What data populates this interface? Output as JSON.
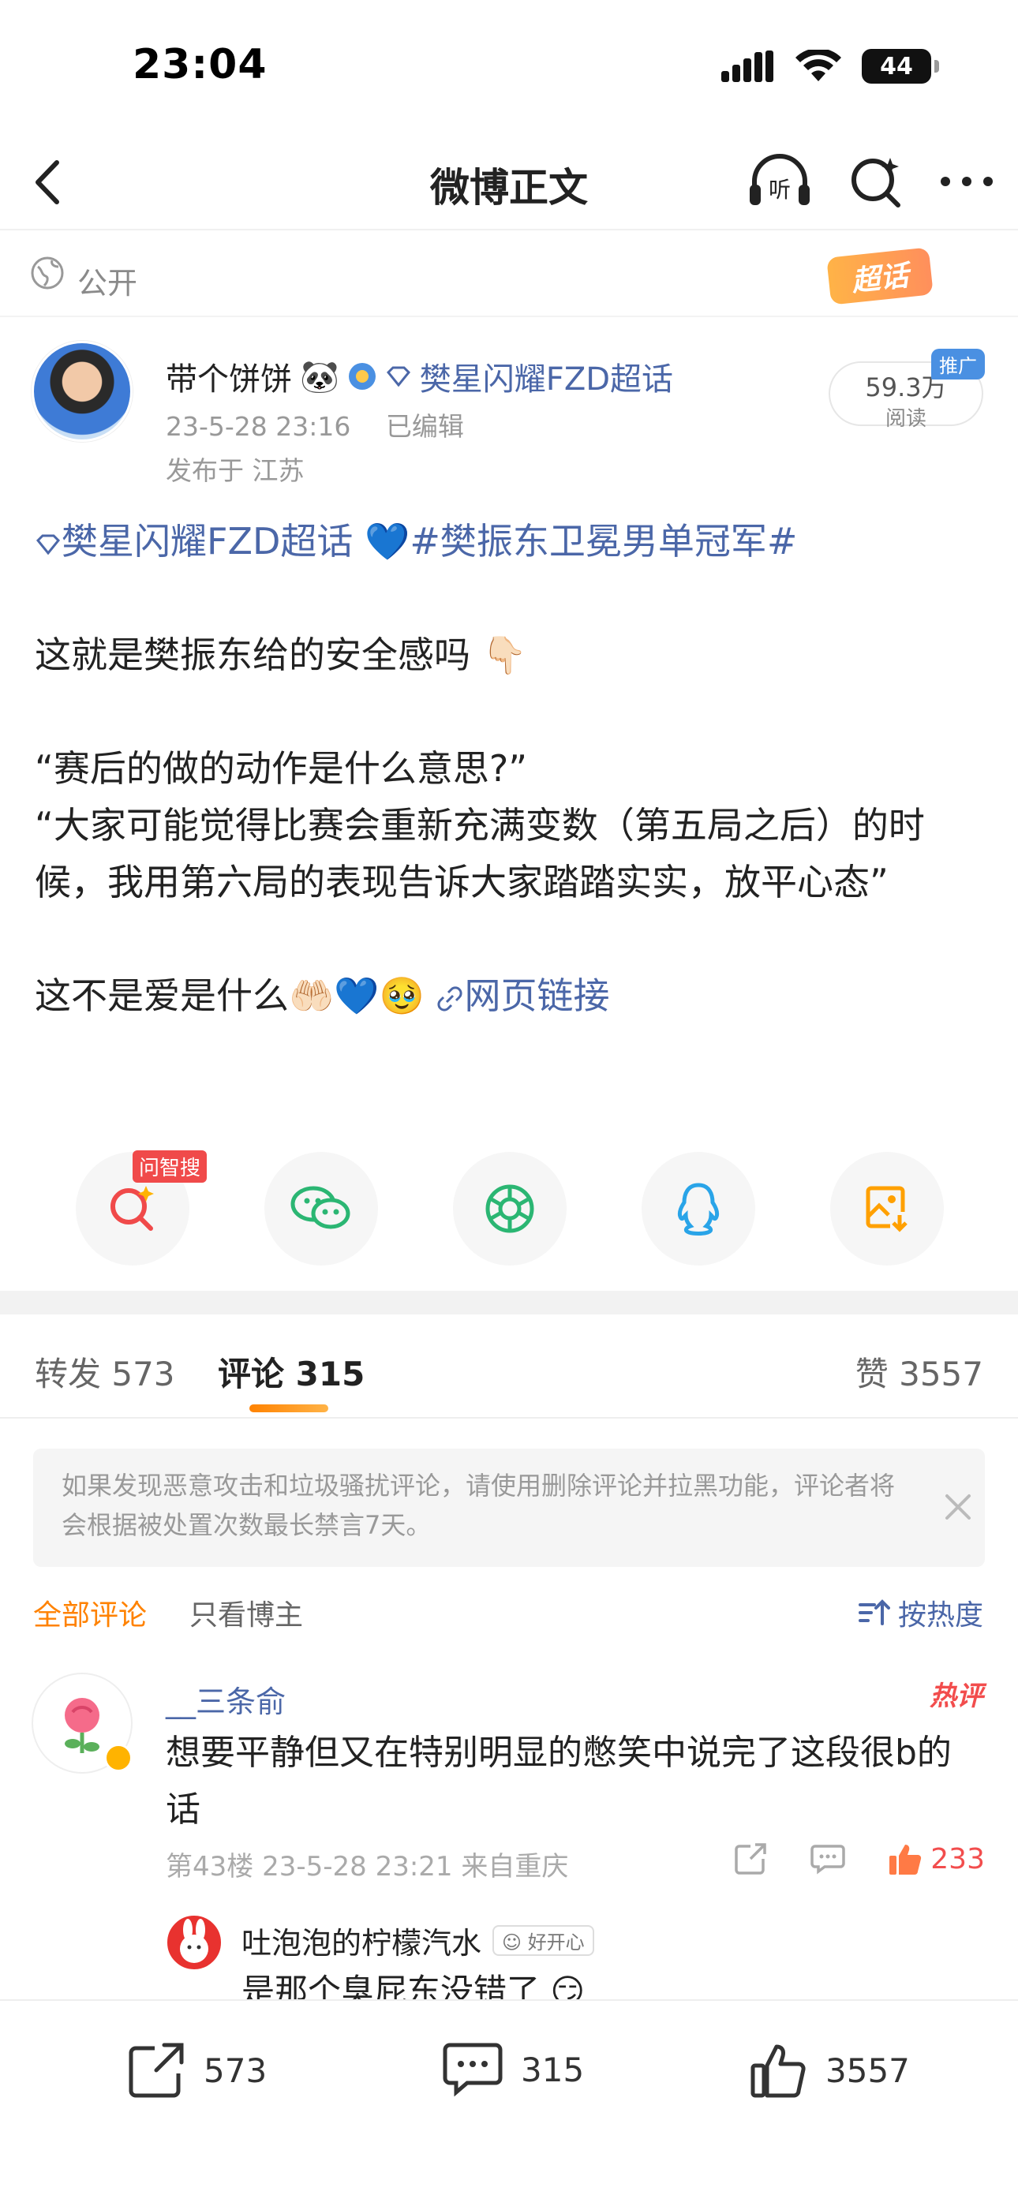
{
  "status_bar": {
    "time": "23:04",
    "battery": "44"
  },
  "nav": {
    "title": "微博正文"
  },
  "visibility": {
    "label": "公开",
    "badge": "超话"
  },
  "author": {
    "name": "带个饼饼",
    "topic": "樊星闪耀FZD超话",
    "time": "23-5-28 23:16",
    "edited": "已编辑",
    "location": "发布于 江苏",
    "reads": "59.3万",
    "reads_label": "阅读",
    "promo": "推广"
  },
  "post": {
    "tag_topic": "樊星闪耀FZD超话",
    "hashtag": "#樊振东卫冕男单冠军#",
    "line1": "这就是樊振东给的安全感吗",
    "line2": "“赛后的做的动作是什么意思?”",
    "line3": "“大家可能觉得比赛会重新充满变数（第五局之后）的时候，我用第六局的表现告诉大家踏踏实实，放平心态”",
    "line4": "这不是爱是什么",
    "link": "网页链接"
  },
  "share": {
    "search_tag": "问智搜"
  },
  "tabs": {
    "repost": "转发 573",
    "comments": "评论 315",
    "likes": "赞 3557"
  },
  "notice": {
    "text": "如果发现恶意攻击和垃圾骚扰评论，请使用删除评论并拉黑功能，评论者将会根据被处置次数最长禁言7天。"
  },
  "filter": {
    "all": "全部评论",
    "owner": "只看博主",
    "sort": "按热度"
  },
  "comment": {
    "name": "__三条俞",
    "hot": "热评",
    "text": "想要平静但又在特别明显的憋笑中说完了这段很b的话",
    "meta": "第43楼 23-5-28 23:21 来自重庆",
    "likes": "233"
  },
  "reply": {
    "name": "吐泡泡的柠檬汽水",
    "badge": "好开心",
    "text": "是那个臭屁东没错了"
  },
  "bottom": {
    "reposts": "573",
    "comments": "315",
    "likes": "3557"
  },
  "colors": {
    "accent": "#ff8200",
    "link": "#4b67a8",
    "hot": "#f24d4d"
  }
}
